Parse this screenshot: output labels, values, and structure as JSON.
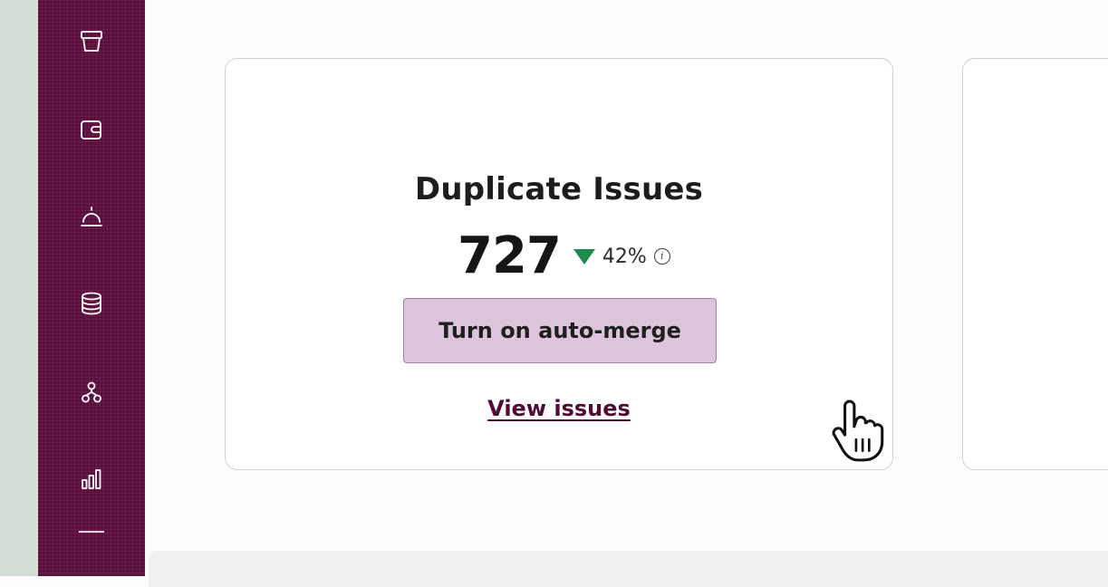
{
  "sidebar": {
    "icons": [
      "trash-bin-icon",
      "wallet-icon",
      "service-bell-icon",
      "database-icon",
      "hierarchy-icon",
      "bar-chart-icon"
    ]
  },
  "card": {
    "title": "Duplicate Issues",
    "metric_value": "727",
    "trend_direction": "down",
    "trend_percent": "42%",
    "trend_color": "#1f8a4e",
    "info_symbol": "i",
    "primary_button_label": "Turn on auto-merge",
    "link_label": "View issues"
  },
  "colors": {
    "sidebar_bg": "#5b0d3b",
    "button_bg": "#dcc5dc",
    "button_border": "#a878a8",
    "link": "#4f0b36",
    "gutter": "#d3dfd6"
  }
}
